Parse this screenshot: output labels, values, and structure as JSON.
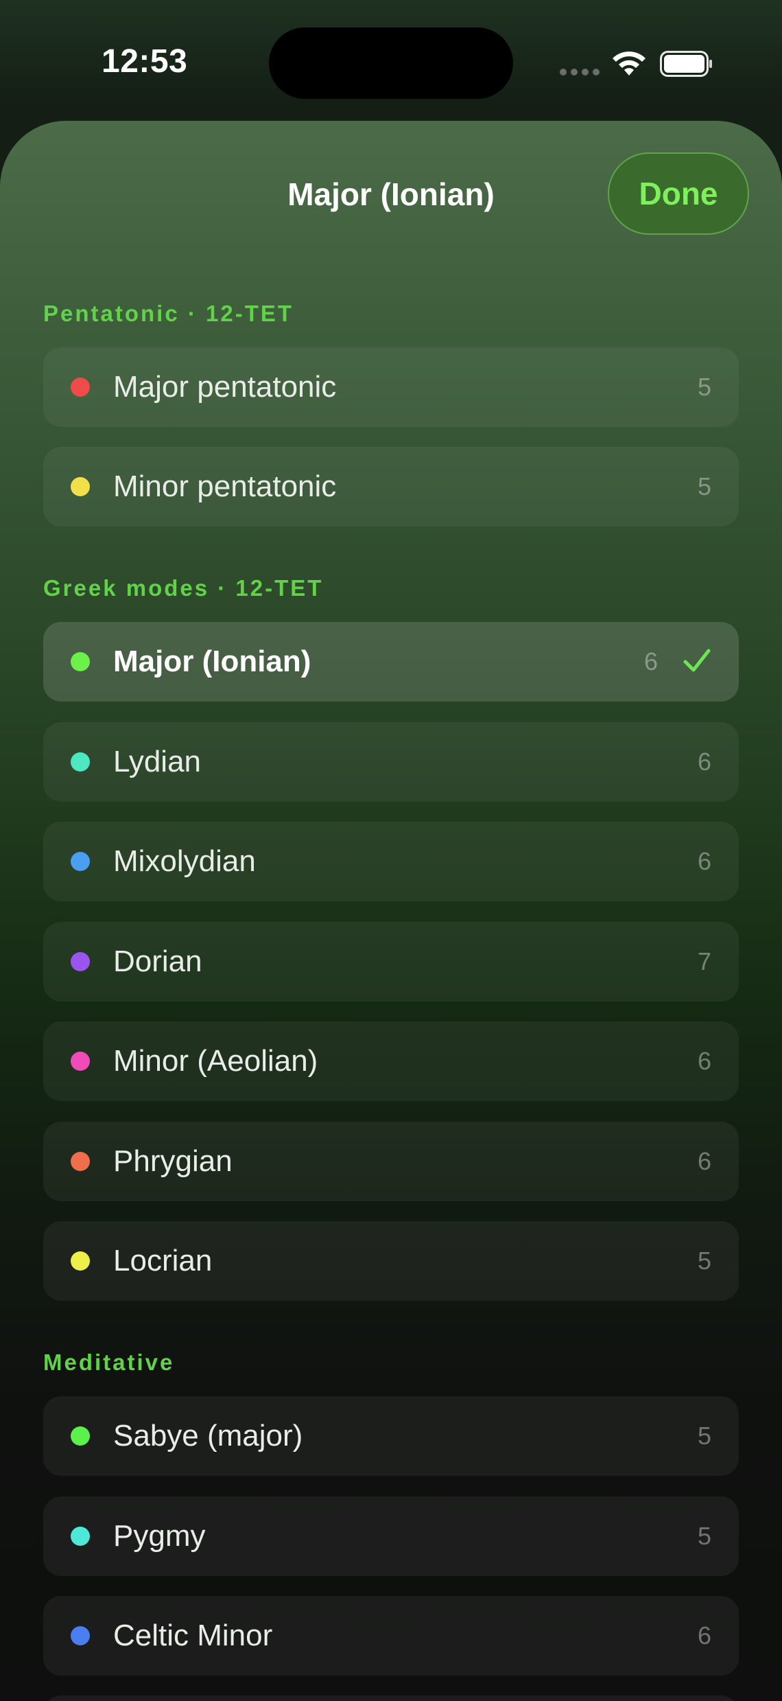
{
  "status_bar": {
    "time": "12:53"
  },
  "sheet": {
    "title": "Major (Ionian)",
    "done_label": "Done"
  },
  "sections": [
    {
      "header": "Pentatonic · 12-TET",
      "items": [
        {
          "label": "Major pentatonic",
          "count": "5",
          "dot_color": "#f04b4b"
        },
        {
          "label": "Minor pentatonic",
          "count": "5",
          "dot_color": "#f2e04a"
        }
      ]
    },
    {
      "header": "Greek modes · 12-TET",
      "items": [
        {
          "label": "Major (Ionian)",
          "count": "6",
          "dot_color": "#6cf04a",
          "selected": true
        },
        {
          "label": "Lydian",
          "count": "6",
          "dot_color": "#4de8c2"
        },
        {
          "label": "Mixolydian",
          "count": "6",
          "dot_color": "#4a9ff2"
        },
        {
          "label": "Dorian",
          "count": "7",
          "dot_color": "#9a55f0"
        },
        {
          "label": "Minor (Aeolian)",
          "count": "6",
          "dot_color": "#f04bb8"
        },
        {
          "label": "Phrygian",
          "count": "6",
          "dot_color": "#f06e4b"
        },
        {
          "label": "Locrian",
          "count": "5",
          "dot_color": "#eef04a"
        }
      ]
    },
    {
      "header": "Meditative",
      "items": [
        {
          "label": "Sabye (major)",
          "count": "5",
          "dot_color": "#5cf04a"
        },
        {
          "label": "Pygmy",
          "count": "5",
          "dot_color": "#4de8d8"
        },
        {
          "label": "Celtic Minor",
          "count": "6",
          "dot_color": "#4a7ff2"
        }
      ]
    }
  ],
  "colors": {
    "accent": "#62d24a",
    "check": "#6ee64f"
  }
}
